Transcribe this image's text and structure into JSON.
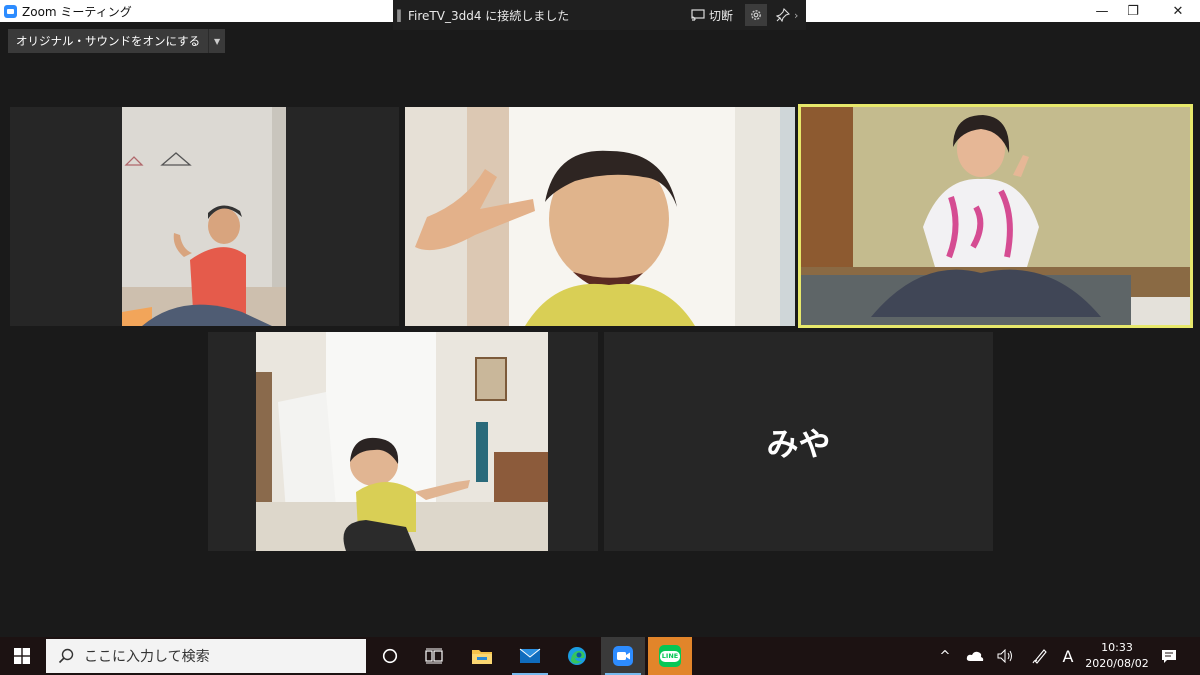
{
  "window": {
    "app_title": "Zoom ミーティング",
    "minimize_glyph": "—",
    "restore_glyph": "❐",
    "close_glyph": "✕"
  },
  "cast_bar": {
    "handle_glyph": "‖",
    "title": "FireTV_3dd4 に接続しました",
    "disconnect_label": "切断",
    "more_glyph": "›",
    "icons": [
      "cast-icon",
      "gear-icon",
      "pin-icon"
    ]
  },
  "meeting": {
    "original_sound_label": "オリジナル・サウンドをオンにする",
    "active_speaker_color": "#e7e86b",
    "participants": [
      {
        "tile": "participant-1",
        "kind": "video"
      },
      {
        "tile": "participant-2",
        "kind": "video"
      },
      {
        "tile": "participant-3",
        "kind": "video",
        "active_speaker": true
      },
      {
        "tile": "participant-4",
        "kind": "video"
      },
      {
        "tile": "participant-5",
        "kind": "name",
        "name": "みや"
      }
    ]
  },
  "taskbar": {
    "search_placeholder": "ここに入力して検索",
    "apps": [
      "cortana-icon",
      "task-view-icon",
      "file-explorer-icon",
      "mail-icon",
      "edge-icon",
      "zoom-icon",
      "line-icon"
    ],
    "line_label": "LINE",
    "tray_chevron": "^",
    "ime_label": "A",
    "time": "10:33",
    "date": "2020/08/02",
    "tray_icons": [
      "chevron-up-icon",
      "onedrive-icon",
      "volume-icon",
      "pen-icon",
      "ime-icon",
      "notification-icon"
    ]
  }
}
